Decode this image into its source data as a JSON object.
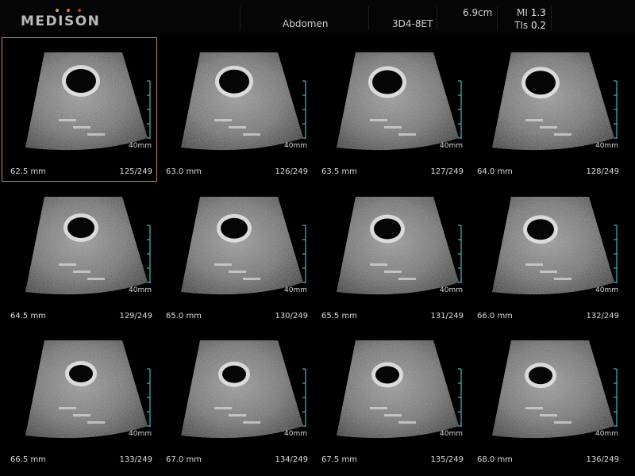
{
  "header": {
    "logo_text": "MEDISON",
    "logo_dot_colors": [
      "#e0a040",
      "#d67a30",
      "#c83a2c"
    ],
    "preset": "Abdomen",
    "probe": "3D4-8ET",
    "depth": "6.9cm",
    "mi_label": "MI",
    "mi_value": "1.3",
    "tis_label": "TIs",
    "tis_value": "0.2"
  },
  "scale_color": "#3fb8b0",
  "slices": [
    {
      "position": "62.5 mm",
      "index": "125/249",
      "depth": "40mm",
      "selected": true
    },
    {
      "position": "63.0 mm",
      "index": "126/249",
      "depth": "40mm",
      "selected": false
    },
    {
      "position": "63.5 mm",
      "index": "127/249",
      "depth": "40mm",
      "selected": false
    },
    {
      "position": "64.0 mm",
      "index": "128/249",
      "depth": "40mm",
      "selected": false
    },
    {
      "position": "64.5 mm",
      "index": "129/249",
      "depth": "40mm",
      "selected": false
    },
    {
      "position": "65.0 mm",
      "index": "130/249",
      "depth": "40mm",
      "selected": false
    },
    {
      "position": "65.5 mm",
      "index": "131/249",
      "depth": "40mm",
      "selected": false
    },
    {
      "position": "66.0 mm",
      "index": "132/249",
      "depth": "40mm",
      "selected": false
    },
    {
      "position": "66.5 mm",
      "index": "133/249",
      "depth": "40mm",
      "selected": false
    },
    {
      "position": "67.0 mm",
      "index": "134/249",
      "depth": "40mm",
      "selected": false
    },
    {
      "position": "67.5 mm",
      "index": "135/249",
      "depth": "40mm",
      "selected": false
    },
    {
      "position": "68.0 mm",
      "index": "136/249",
      "depth": "40mm",
      "selected": false
    }
  ]
}
